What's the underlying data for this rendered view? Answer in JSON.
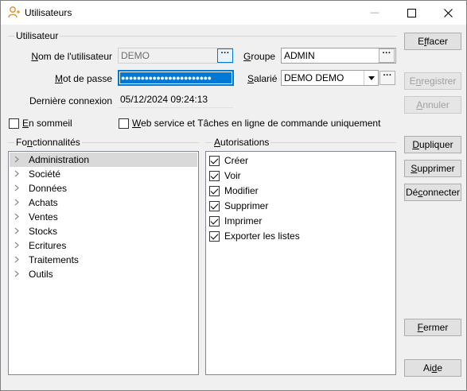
{
  "window": {
    "title": "Utilisateurs",
    "minimize_glyph": "—",
    "maximize_glyph": "☐",
    "close_glyph": "✕",
    "icon": "user-icon"
  },
  "user_group": {
    "label": "Utilisateur",
    "username": {
      "label_pre": "N",
      "label_rest": "om de l'utilisateur",
      "value": "DEMO",
      "button": "···"
    },
    "password": {
      "label_pre": "M",
      "label_rest": "ot de passe",
      "value": "●●●●●●●●●●●●●●●●●●●●●●●"
    },
    "last_login": {
      "label": "Dernière connexion",
      "value": "05/12/2024 09:24:13"
    },
    "groupe": {
      "label_pre": "G",
      "label_rest": "roupe",
      "value": "ADMIN",
      "button": "···"
    },
    "salarie": {
      "label_pre": "S",
      "label_rest": "alarié",
      "value": "DEMO DEMO",
      "button": "···"
    }
  },
  "checkboxes": {
    "sleep": {
      "label_pre": "E",
      "label_rest": "n sommeil",
      "checked": false
    },
    "webservice": {
      "label_pre": "W",
      "label_rest": "eb service et Tâches en ligne de commande uniquement",
      "checked": false
    }
  },
  "features": {
    "label_pre": "Fo",
    "label_u": "n",
    "label_rest": "ctionnalités",
    "items": [
      "Administration",
      "Société",
      "Données",
      "Achats",
      "Ventes",
      "Stocks",
      "Ecritures",
      "Traitements",
      "Outils"
    ],
    "selected_index": 0
  },
  "permissions": {
    "label_pre": "A",
    "label_rest": "utorisations",
    "items": [
      {
        "label": "Créer",
        "checked": true
      },
      {
        "label": "Voir",
        "checked": true
      },
      {
        "label": "Modifier",
        "checked": true
      },
      {
        "label": "Supprimer",
        "checked": true
      },
      {
        "label": "Imprimer",
        "checked": true
      },
      {
        "label": "Exporter les listes",
        "checked": true
      }
    ]
  },
  "buttons": {
    "effacer": {
      "pre": "E",
      "u": "f",
      "rest": "facer",
      "enabled": true
    },
    "enregistrer": {
      "pre": "E",
      "u": "n",
      "rest": "registrer",
      "enabled": false
    },
    "annuler": {
      "pre": "",
      "u": "A",
      "rest": "nnuler",
      "enabled": false
    },
    "dupliquer": {
      "pre": "",
      "u": "D",
      "rest": "upliquer",
      "enabled": true
    },
    "supprimer": {
      "pre": "",
      "u": "S",
      "rest": "upprimer",
      "enabled": true
    },
    "deconnecter": {
      "pre": "Dé",
      "u": "c",
      "rest": "onnecter",
      "enabled": true
    },
    "fermer": {
      "pre": "",
      "u": "F",
      "rest": "ermer",
      "enabled": true
    },
    "aide": {
      "pre": "Ai",
      "u": "d",
      "rest": "e",
      "enabled": true
    }
  },
  "colors": {
    "accent": "#0078d7",
    "selection": "#d9d9d9",
    "dialog_bg": "#f0f0f0"
  }
}
